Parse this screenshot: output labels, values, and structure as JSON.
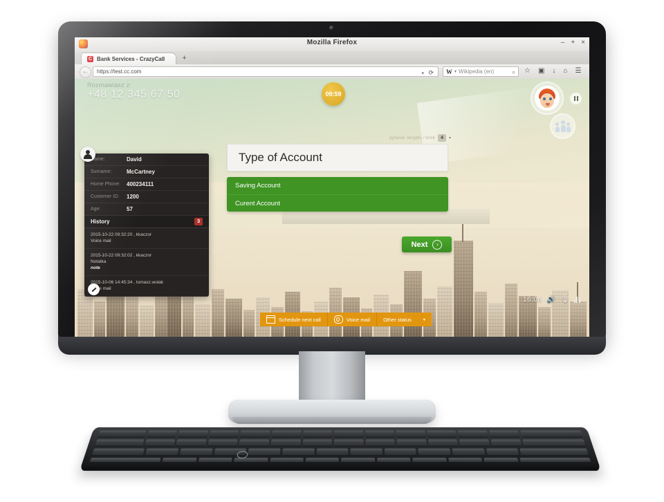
{
  "browser": {
    "window_title": "Mozilla Firefox",
    "window_controls": {
      "minimize": "–",
      "maximize": "+",
      "close": "×"
    },
    "tab": {
      "favicon_letter": "C",
      "title": "Bank Services - CrazyCall"
    },
    "new_tab_label": "+",
    "back_arrow": "←",
    "url": "https://test.cc.com",
    "url_caret": "▾",
    "reload": "⟳",
    "search": {
      "engine_glyph": "W",
      "engine_caret": "▾",
      "placeholder": "Wikipedia (en)",
      "magnifier": "⌕"
    },
    "toolbar_icons": [
      "☆",
      "▣",
      "↓",
      "⌂",
      "☰"
    ]
  },
  "call_header": {
    "talking_label": "Rozmawiasz z:",
    "phone_number": "+48 12 345 67 50",
    "timer": "09:59"
  },
  "contact": {
    "rows": [
      {
        "key": "Name:",
        "value": "David"
      },
      {
        "key": "Surname:",
        "value": "McCartney"
      },
      {
        "key": "Home Phone:",
        "value": "400234111"
      },
      {
        "key": "Customer ID:",
        "value": "1200"
      },
      {
        "key": "Age:",
        "value": "57"
      }
    ],
    "history_title": "History",
    "history_count": "3",
    "history_items": [
      {
        "meta": "2015-10-22 09:32:20 , kkaczor",
        "type": "Voice mail",
        "note": ""
      },
      {
        "meta": "2015-10-22 09:32:02 , kkaczor",
        "type": "Notatka",
        "note": "note"
      },
      {
        "meta": "2015-10-06 14:45:34 , tomasz.wolak",
        "type": "Voice mail",
        "note": ""
      }
    ]
  },
  "script_panel": {
    "meta_text": "pytanie skryptu / krok",
    "meta_badge": "4",
    "meta_caret": "▾",
    "question": "Type of Account",
    "answers": [
      "Saving Account",
      "Curent Account"
    ],
    "next_label": "Next",
    "next_chevron": "›"
  },
  "status_bar": {
    "buttons": [
      {
        "label": "Schedule next call",
        "icon": "calendar-icon"
      },
      {
        "label": "Voice mail",
        "icon": "voicemail-icon"
      },
      {
        "label": "Other status",
        "icon": "",
        "caret": "▾"
      }
    ]
  },
  "media_controls": {
    "time": "16:06",
    "speaker_icon": "🔊",
    "mic_icon": "🎙",
    "levels_icon": "bars-icon"
  },
  "colors": {
    "accent_green": "#3f9424",
    "accent_orange": "#e2960f",
    "timer_gold": "#e0b02f",
    "badge_red": "#a9322c"
  }
}
